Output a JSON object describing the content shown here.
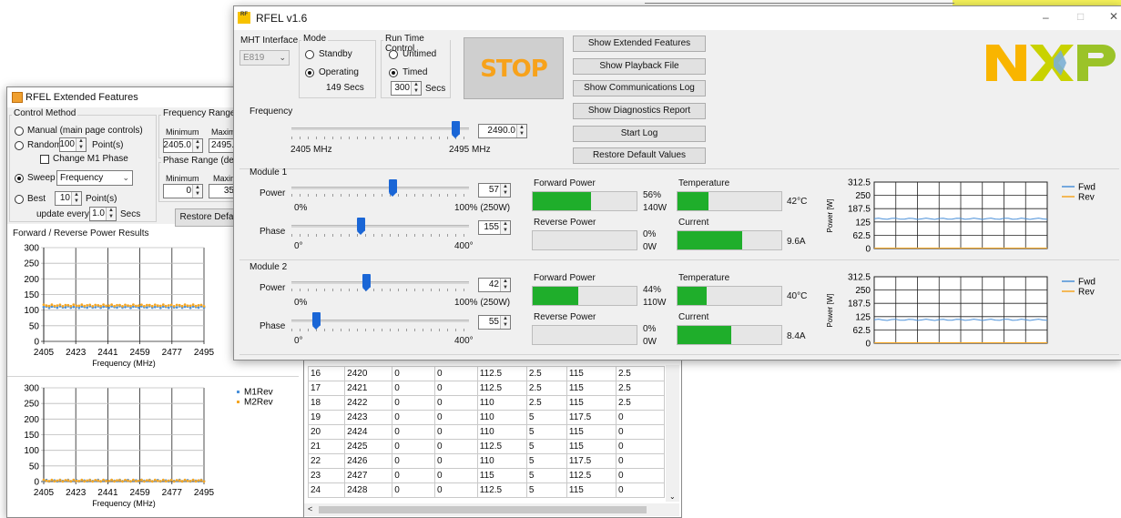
{
  "ext": {
    "title": "RFEL Extended Features",
    "control_method_title": "Control Method",
    "radio_manual": "Manual (main page controls)",
    "radio_random": "Random",
    "random_points": "100",
    "points_label": "Point(s)",
    "change_m1_phase": "Change M1 Phase",
    "radio_sweep": "Sweep",
    "sweep_select": "Frequency",
    "radio_best": "Best",
    "best_points": "10",
    "best_points_label": "Point(s)",
    "update_every": "update every",
    "update_value": "1.0",
    "secs": "Secs",
    "freq_range_title": "Frequency Range (M",
    "minimum": "Minimum",
    "maximum": "Maxim",
    "freq_min": "2405.0",
    "freq_max": "2495.",
    "phase_range_title": "Phase Range (degre",
    "phase_min": "0",
    "phase_max": "35",
    "restore_btn": "Restore Defa",
    "results_title": "Forward / Reverse Power Results",
    "chart_xlabel": "Frequency (MHz)",
    "chart2_legend": [
      "M1Rev",
      "M2Rev"
    ]
  },
  "main": {
    "title": "RFEL v1.6",
    "mht_interface": "MHT Interface",
    "mht_value": "E819",
    "mode_title": "Mode",
    "standby": "Standby",
    "operating": "Operating",
    "operating_secs": "149 Secs",
    "runtime_title": "Run Time Control",
    "untimed": "Untimed",
    "timed": "Timed",
    "timed_value": "300",
    "timed_secs": "Secs",
    "stop": "STOP",
    "btn_ext": "Show Extended Features",
    "btn_playback": "Show Playback File",
    "btn_comms": "Show Communications Log",
    "btn_diag": "Show Diagnostics Report",
    "btn_startlog": "Start Log",
    "btn_restore": "Restore Default Values",
    "frequency": "Frequency",
    "freq_value": "2490.0",
    "freq_min_label": "2405 MHz",
    "freq_max_label": "2495 MHz",
    "window_controls": [
      "–",
      "□",
      "✕"
    ]
  },
  "modules": [
    {
      "title": "Module 1",
      "power_label": "Power",
      "power_value": "57",
      "power_min": "0%",
      "power_max": "100% (250W)",
      "phase_label": "Phase",
      "phase_value": "155",
      "phase_min": "0°",
      "phase_max": "400°",
      "fwd_title": "Forward Power",
      "fwd_pct": "56%",
      "fwd_w": "140W",
      "rev_title": "Reverse Power",
      "rev_pct": "0%",
      "rev_w": "0W",
      "temp_title": "Temperature",
      "temp_value": "42°C",
      "cur_title": "Current",
      "cur_value": "9.6A",
      "levels": {
        "power": 0.57,
        "phase": 0.3875,
        "fwd": 0.56,
        "rev": 0.0,
        "temp": 0.3,
        "cur": 0.62
      }
    },
    {
      "title": "Module 2",
      "power_label": "Power",
      "power_value": "42",
      "power_min": "0%",
      "power_max": "100% (250W)",
      "phase_label": "Phase",
      "phase_value": "55",
      "phase_min": "0°",
      "phase_max": "400°",
      "fwd_title": "Forward Power",
      "fwd_pct": "44%",
      "fwd_w": "110W",
      "rev_title": "Reverse Power",
      "rev_pct": "0%",
      "rev_w": "0W",
      "temp_title": "Temperature",
      "temp_value": "40°C",
      "cur_title": "Current",
      "cur_value": "8.4A",
      "levels": {
        "power": 0.42,
        "phase": 0.1375,
        "fwd": 0.44,
        "rev": 0.0,
        "temp": 0.28,
        "cur": 0.52
      }
    }
  ],
  "power_chart": {
    "ylabel": "Power [W]",
    "yticks": [
      "312.5",
      "250",
      "187.5",
      "125",
      "62.5",
      "0"
    ],
    "legend": [
      "Fwd",
      "Rev"
    ]
  },
  "table_rows": [
    [
      "16",
      "2420",
      "0",
      "0",
      "112.5",
      "2.5",
      "115",
      "2.5"
    ],
    [
      "17",
      "2421",
      "0",
      "0",
      "112.5",
      "2.5",
      "115",
      "2.5"
    ],
    [
      "18",
      "2422",
      "0",
      "0",
      "110",
      "2.5",
      "115",
      "2.5"
    ],
    [
      "19",
      "2423",
      "0",
      "0",
      "110",
      "5",
      "117.5",
      "0"
    ],
    [
      "20",
      "2424",
      "0",
      "0",
      "110",
      "5",
      "115",
      "0"
    ],
    [
      "21",
      "2425",
      "0",
      "0",
      "112.5",
      "5",
      "115",
      "0"
    ],
    [
      "22",
      "2426",
      "0",
      "0",
      "110",
      "5",
      "117.5",
      "0"
    ],
    [
      "23",
      "2427",
      "0",
      "0",
      "115",
      "5",
      "112.5",
      "0"
    ],
    [
      "24",
      "2428",
      "0",
      "0",
      "112.5",
      "5",
      "115",
      "0"
    ]
  ],
  "colors": {
    "fwd": "#4a90d9",
    "rev": "#f5a623",
    "green": "#1fae2b",
    "stop_bg": "#cfcfcf",
    "stop_text": "#f7a21b"
  },
  "chart_data": [
    {
      "type": "scatter",
      "xticks": [
        "2405",
        "2423",
        "2441",
        "2459",
        "2477",
        "2495"
      ],
      "yticks": [
        "300",
        "250",
        "200",
        "150",
        "100",
        "50",
        "0"
      ],
      "xlabel": "Frequency (MHz)",
      "ylim": [
        0,
        300
      ],
      "xlim": [
        2405,
        2495
      ],
      "series": [
        {
          "x": [
            2405,
            2495
          ],
          "y": [
            110,
            110
          ],
          "color": "#4a90d9"
        },
        {
          "x": [
            2405,
            2495
          ],
          "y": [
            115,
            115
          ],
          "color": "#f5a623"
        }
      ]
    },
    {
      "type": "scatter",
      "xticks": [
        "2405",
        "2423",
        "2441",
        "2459",
        "2477",
        "2495"
      ],
      "yticks": [
        "300",
        "250",
        "200",
        "150",
        "100",
        "50",
        "0"
      ],
      "xlabel": "Frequency (MHz)",
      "ylim": [
        0,
        300
      ],
      "xlim": [
        2405,
        2495
      ],
      "series": [
        {
          "name": "M1Rev",
          "x": [
            2405,
            2495
          ],
          "y": [
            3,
            3
          ],
          "color": "#4a90d9"
        },
        {
          "name": "M2Rev",
          "x": [
            2405,
            2495
          ],
          "y": [
            3,
            3
          ],
          "color": "#f5a623"
        }
      ]
    }
  ]
}
